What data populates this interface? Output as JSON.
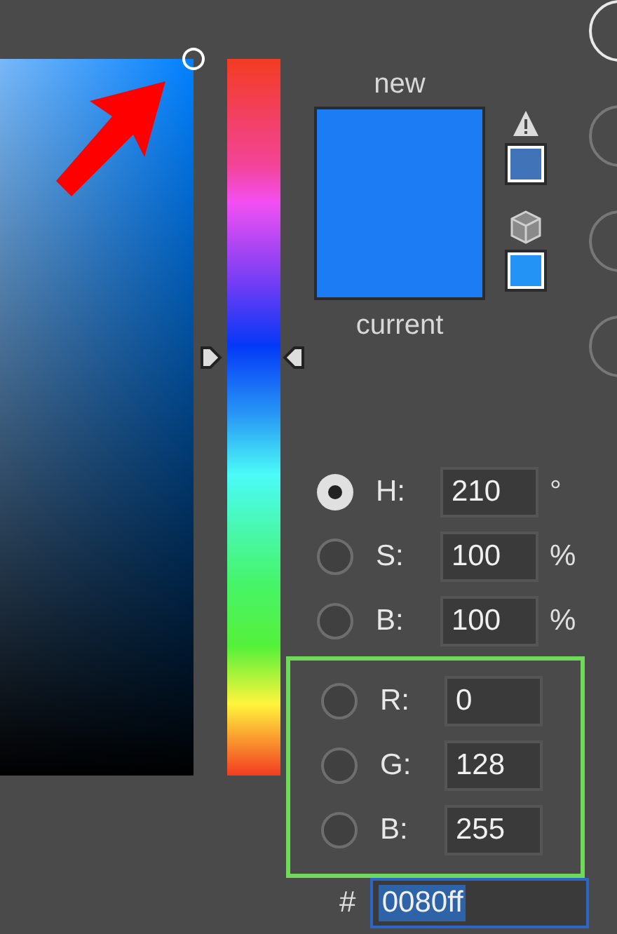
{
  "hue_slider": {
    "level": 0.583
  },
  "preview": {
    "new": {
      "label": "new",
      "color": "#1b7cf3"
    },
    "current": {
      "label": "current",
      "color": "#1b7cf3"
    }
  },
  "gamut_warning": {
    "color": "#4173b8"
  },
  "web_safe_warning": {
    "color": "#2393f5"
  },
  "hsb_fields": [
    {
      "label": "H:",
      "value": "210",
      "unit": "°",
      "selected": true
    },
    {
      "label": "S:",
      "value": "100",
      "unit": "%",
      "selected": false
    },
    {
      "label": "B:",
      "value": "100",
      "unit": "%",
      "selected": false
    }
  ],
  "rgb_fields": [
    {
      "label": "R:",
      "value": "0",
      "selected": false
    },
    {
      "label": "G:",
      "value": "128",
      "selected": false
    },
    {
      "label": "B:",
      "value": "255",
      "selected": false
    }
  ],
  "hex": {
    "label": "#",
    "value": "0080ff",
    "text_selected": true
  },
  "annotations": {
    "arrow_shown": true,
    "rgb_outlined": true
  }
}
